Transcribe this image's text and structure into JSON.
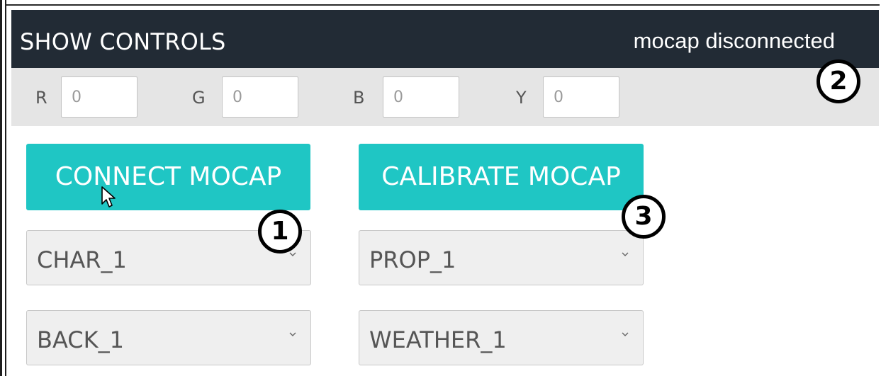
{
  "header": {
    "title": "SHOW CONTROLS",
    "status": "mocap disconnected"
  },
  "colors": {
    "r": {
      "label": "R",
      "value": "0"
    },
    "g": {
      "label": "G",
      "value": "0"
    },
    "b": {
      "label": "B",
      "value": "0"
    },
    "y": {
      "label": "Y",
      "value": "0"
    }
  },
  "buttons": {
    "connect": "CONNECT MOCAP",
    "calibrate": "CALIBRATE MOCAP"
  },
  "selects": {
    "char": "CHAR_1",
    "prop": "PROP_1",
    "back": "BACK_1",
    "weather": "WEATHER_1"
  },
  "callouts": [
    "1",
    "2",
    "3"
  ],
  "theme": {
    "header_bg": "#222b35",
    "accent": "#1fc6c4",
    "bar_bg": "#e5e5e5"
  }
}
